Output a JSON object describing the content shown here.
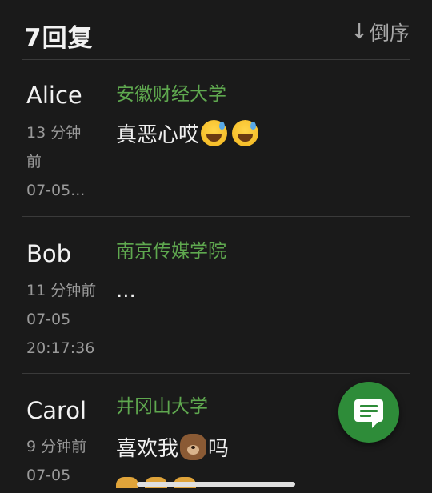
{
  "header": {
    "reply_count": "7回复",
    "sort_label": "倒序",
    "sort_icon": "arrow-down-icon"
  },
  "comments": [
    {
      "user": "Alice",
      "school": "安徽财经大学",
      "time_lines": [
        "13 分钟",
        "前",
        "07-05..."
      ],
      "text": "真恶心哎",
      "emojis": [
        "sweat-smile-emoji",
        "sweat-smile-emoji"
      ]
    },
    {
      "user": "Bob",
      "school": "南京传媒学院",
      "time_lines": [
        "11 分钟前",
        "07-05",
        "20:17:36"
      ],
      "text": "...",
      "emojis": []
    },
    {
      "user": "Carol",
      "school": "井冈山大学",
      "time_lines": [
        "9 分钟前",
        "07-05"
      ],
      "text_before": "喜欢我",
      "text_after": "吗",
      "emojis": [
        "bear-emoji"
      ]
    }
  ],
  "fab": {
    "icon": "comment-icon"
  },
  "colors": {
    "background": "#1a1a1a",
    "school": "#5fa84f",
    "fab": "#2e8c39",
    "meta": "#9a9a9a"
  }
}
